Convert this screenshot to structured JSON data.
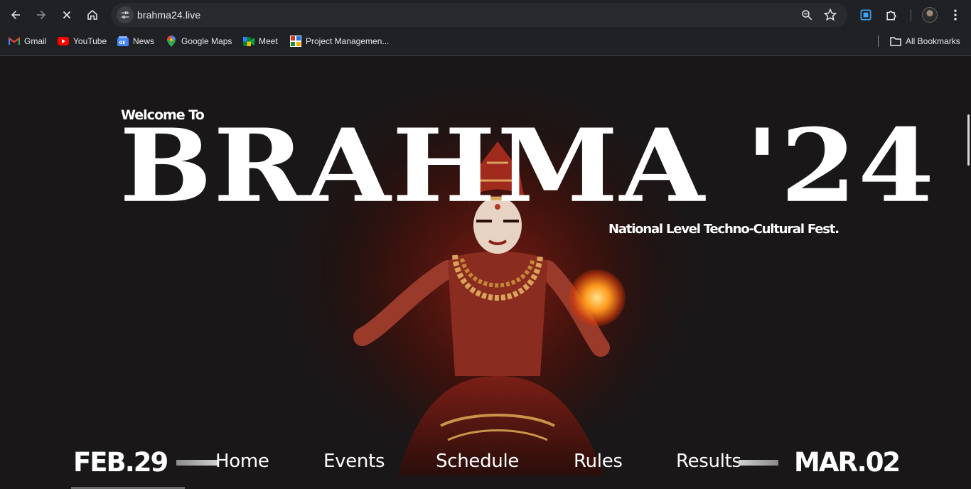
{
  "browser": {
    "url": "brahma24.live",
    "bookmarks": [
      {
        "label": "Gmail",
        "icon": "gmail-icon"
      },
      {
        "label": "YouTube",
        "icon": "youtube-icon"
      },
      {
        "label": "News",
        "icon": "news-icon"
      },
      {
        "label": "Google Maps",
        "icon": "maps-icon"
      },
      {
        "label": "Meet",
        "icon": "meet-icon"
      },
      {
        "label": "Project Managemen...",
        "icon": "project-icon"
      }
    ],
    "all_bookmarks": "All Bookmarks"
  },
  "hero": {
    "welcome": "Welcome To",
    "title": "BRAHMA '24",
    "tagline": "National Level Techno-Cultural Fest."
  },
  "dates": {
    "start": "FEB.29",
    "end": "MAR.02"
  },
  "nav": {
    "items": [
      "Home",
      "Events",
      "Schedule",
      "Rules",
      "Results"
    ]
  },
  "colors": {
    "page_bg": "#1a1718",
    "accent_red": "#b23a24",
    "text": "#ffffff"
  }
}
